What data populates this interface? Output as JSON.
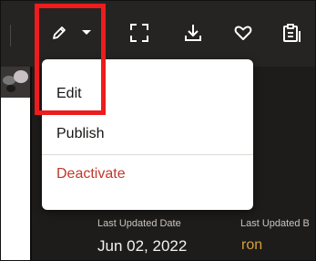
{
  "toolbar": {
    "icons": [
      "edit-pencil-icon",
      "chevron-down-icon",
      "fullscreen-icon",
      "download-icon",
      "heart-icon",
      "clipboard-icon"
    ]
  },
  "menu": {
    "items": [
      {
        "label": "Edit"
      },
      {
        "label": "Publish"
      },
      {
        "label": "Deactivate",
        "style": "danger"
      }
    ]
  },
  "details": {
    "last_updated_date_label": "Last Updated Date",
    "last_updated_date_value": "Jun 02, 2022",
    "last_updated_by_label": "Last Updated B",
    "last_updated_by_value": "ron"
  },
  "colors": {
    "highlight": "#ee1c1c",
    "danger": "#c0382b",
    "link": "#d4a13a",
    "toolbar_bg": "#262422"
  }
}
